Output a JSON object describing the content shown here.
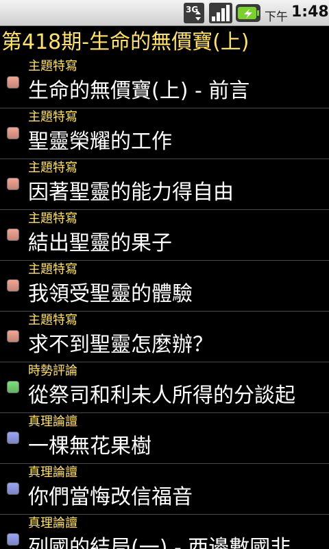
{
  "status_bar": {
    "network_badge": "3G",
    "icons": [
      "3g-data-icon",
      "signal-strength-icon",
      "battery-charging-icon"
    ],
    "ampm": "下午",
    "time": "1:48"
  },
  "page": {
    "title": "第418期-生命的無價寶(上)"
  },
  "colors": {
    "title_yellow": "#ffe45a",
    "background": "#000000",
    "bullet_red": "#f3a593",
    "bullet_green": "#7de07a",
    "bullet_blue": "#9aa5f5"
  },
  "articles": [
    {
      "category": "主題特寫",
      "title": "生命的無價寶(上) - 前言",
      "bullet_color": "#f3a593"
    },
    {
      "category": "主題特寫",
      "title": "聖靈榮耀的工作",
      "bullet_color": "#f3a593"
    },
    {
      "category": "主題特寫",
      "title": "因著聖靈的能力得自由",
      "bullet_color": "#f3a593"
    },
    {
      "category": "主題特寫",
      "title": "結出聖靈的果子",
      "bullet_color": "#f3a593"
    },
    {
      "category": "主題特寫",
      "title": "我領受聖靈的體驗",
      "bullet_color": "#f3a593"
    },
    {
      "category": "主題特寫",
      "title": "求不到聖靈怎麼辦？",
      "bullet_color": "#f3a593"
    },
    {
      "category": "時勢評論",
      "title": "從祭司和利未人所得的分談起",
      "bullet_color": "#7de07a"
    },
    {
      "category": "真理論譠",
      "title": "一棵無花果樹",
      "bullet_color": "#9aa5f5"
    },
    {
      "category": "真理論譠",
      "title": "你們當悔改信福音",
      "bullet_color": "#9aa5f5"
    },
    {
      "category": "真理論譠",
      "title": "列國的結局(一) - 西邊數國非",
      "bullet_color": "#9aa5f5"
    }
  ]
}
